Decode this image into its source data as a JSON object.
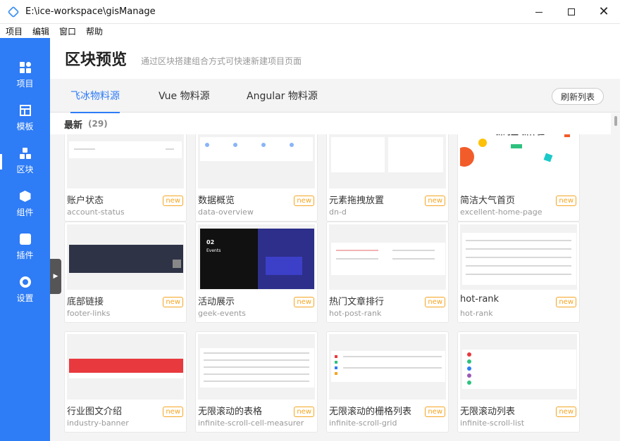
{
  "window": {
    "title": "E:\\ice-workspace\\gisManage",
    "minimize": "minimize-icon",
    "maximize": "maximize-icon",
    "close": "close-icon"
  },
  "menubar": [
    "项目",
    "编辑",
    "窗口",
    "帮助"
  ],
  "sidebar": {
    "items": [
      {
        "label": "项目",
        "icon": "grid-icon",
        "active": false
      },
      {
        "label": "模板",
        "icon": "template-icon",
        "active": false
      },
      {
        "label": "区块",
        "icon": "blocks-icon",
        "active": true
      },
      {
        "label": "组件",
        "icon": "cube-icon",
        "active": false
      },
      {
        "label": "插件",
        "icon": "puzzle-icon",
        "active": false
      },
      {
        "label": "设置",
        "icon": "gear-icon",
        "active": false
      }
    ],
    "accent": "#2e7cf6"
  },
  "header": {
    "title": "区块预览",
    "subtitle": "通过区块搭建组合方式可快速新建项目页面"
  },
  "tabs": [
    {
      "label": "飞冰物料源",
      "active": true
    },
    {
      "label": "Vue 物料源",
      "active": false
    },
    {
      "label": "Angular 物料源",
      "active": false
    }
  ],
  "refresh_label": "刷新列表",
  "section": {
    "title": "最新",
    "count": "(29)"
  },
  "cards": [
    {
      "name": "账户状态",
      "slug": "account-status",
      "badge": "new"
    },
    {
      "name": "数据概览",
      "slug": "data-overview",
      "badge": "new"
    },
    {
      "name": "元素拖拽放置",
      "slug": "dn-d",
      "badge": "new"
    },
    {
      "name": "简洁大气首页",
      "slug": "excellent-home-page",
      "badge": "new"
    },
    {
      "name": "底部链接",
      "slug": "footer-links",
      "badge": "new"
    },
    {
      "name": "活动展示",
      "slug": "geek-events",
      "badge": "new"
    },
    {
      "name": "热门文章排行",
      "slug": "hot-post-rank",
      "badge": "new"
    },
    {
      "name": "hot-rank",
      "slug": "hot-rank",
      "badge": "new"
    },
    {
      "name": "行业图文介绍",
      "slug": "industry-banner",
      "badge": "new"
    },
    {
      "name": "无限滚动的表格",
      "slug": "infinite-scroll-cell-measurer",
      "badge": "new"
    },
    {
      "name": "无限滚动的栅格列表",
      "slug": "infinite-scroll-grid",
      "badge": "new"
    },
    {
      "name": "无限滚动列表",
      "slug": "infinite-scroll-list",
      "badge": "new"
    }
  ],
  "previews": {
    "geek_events": {
      "number": "02",
      "word": "Events"
    },
    "home_banner": "新淘宝 新体验"
  }
}
